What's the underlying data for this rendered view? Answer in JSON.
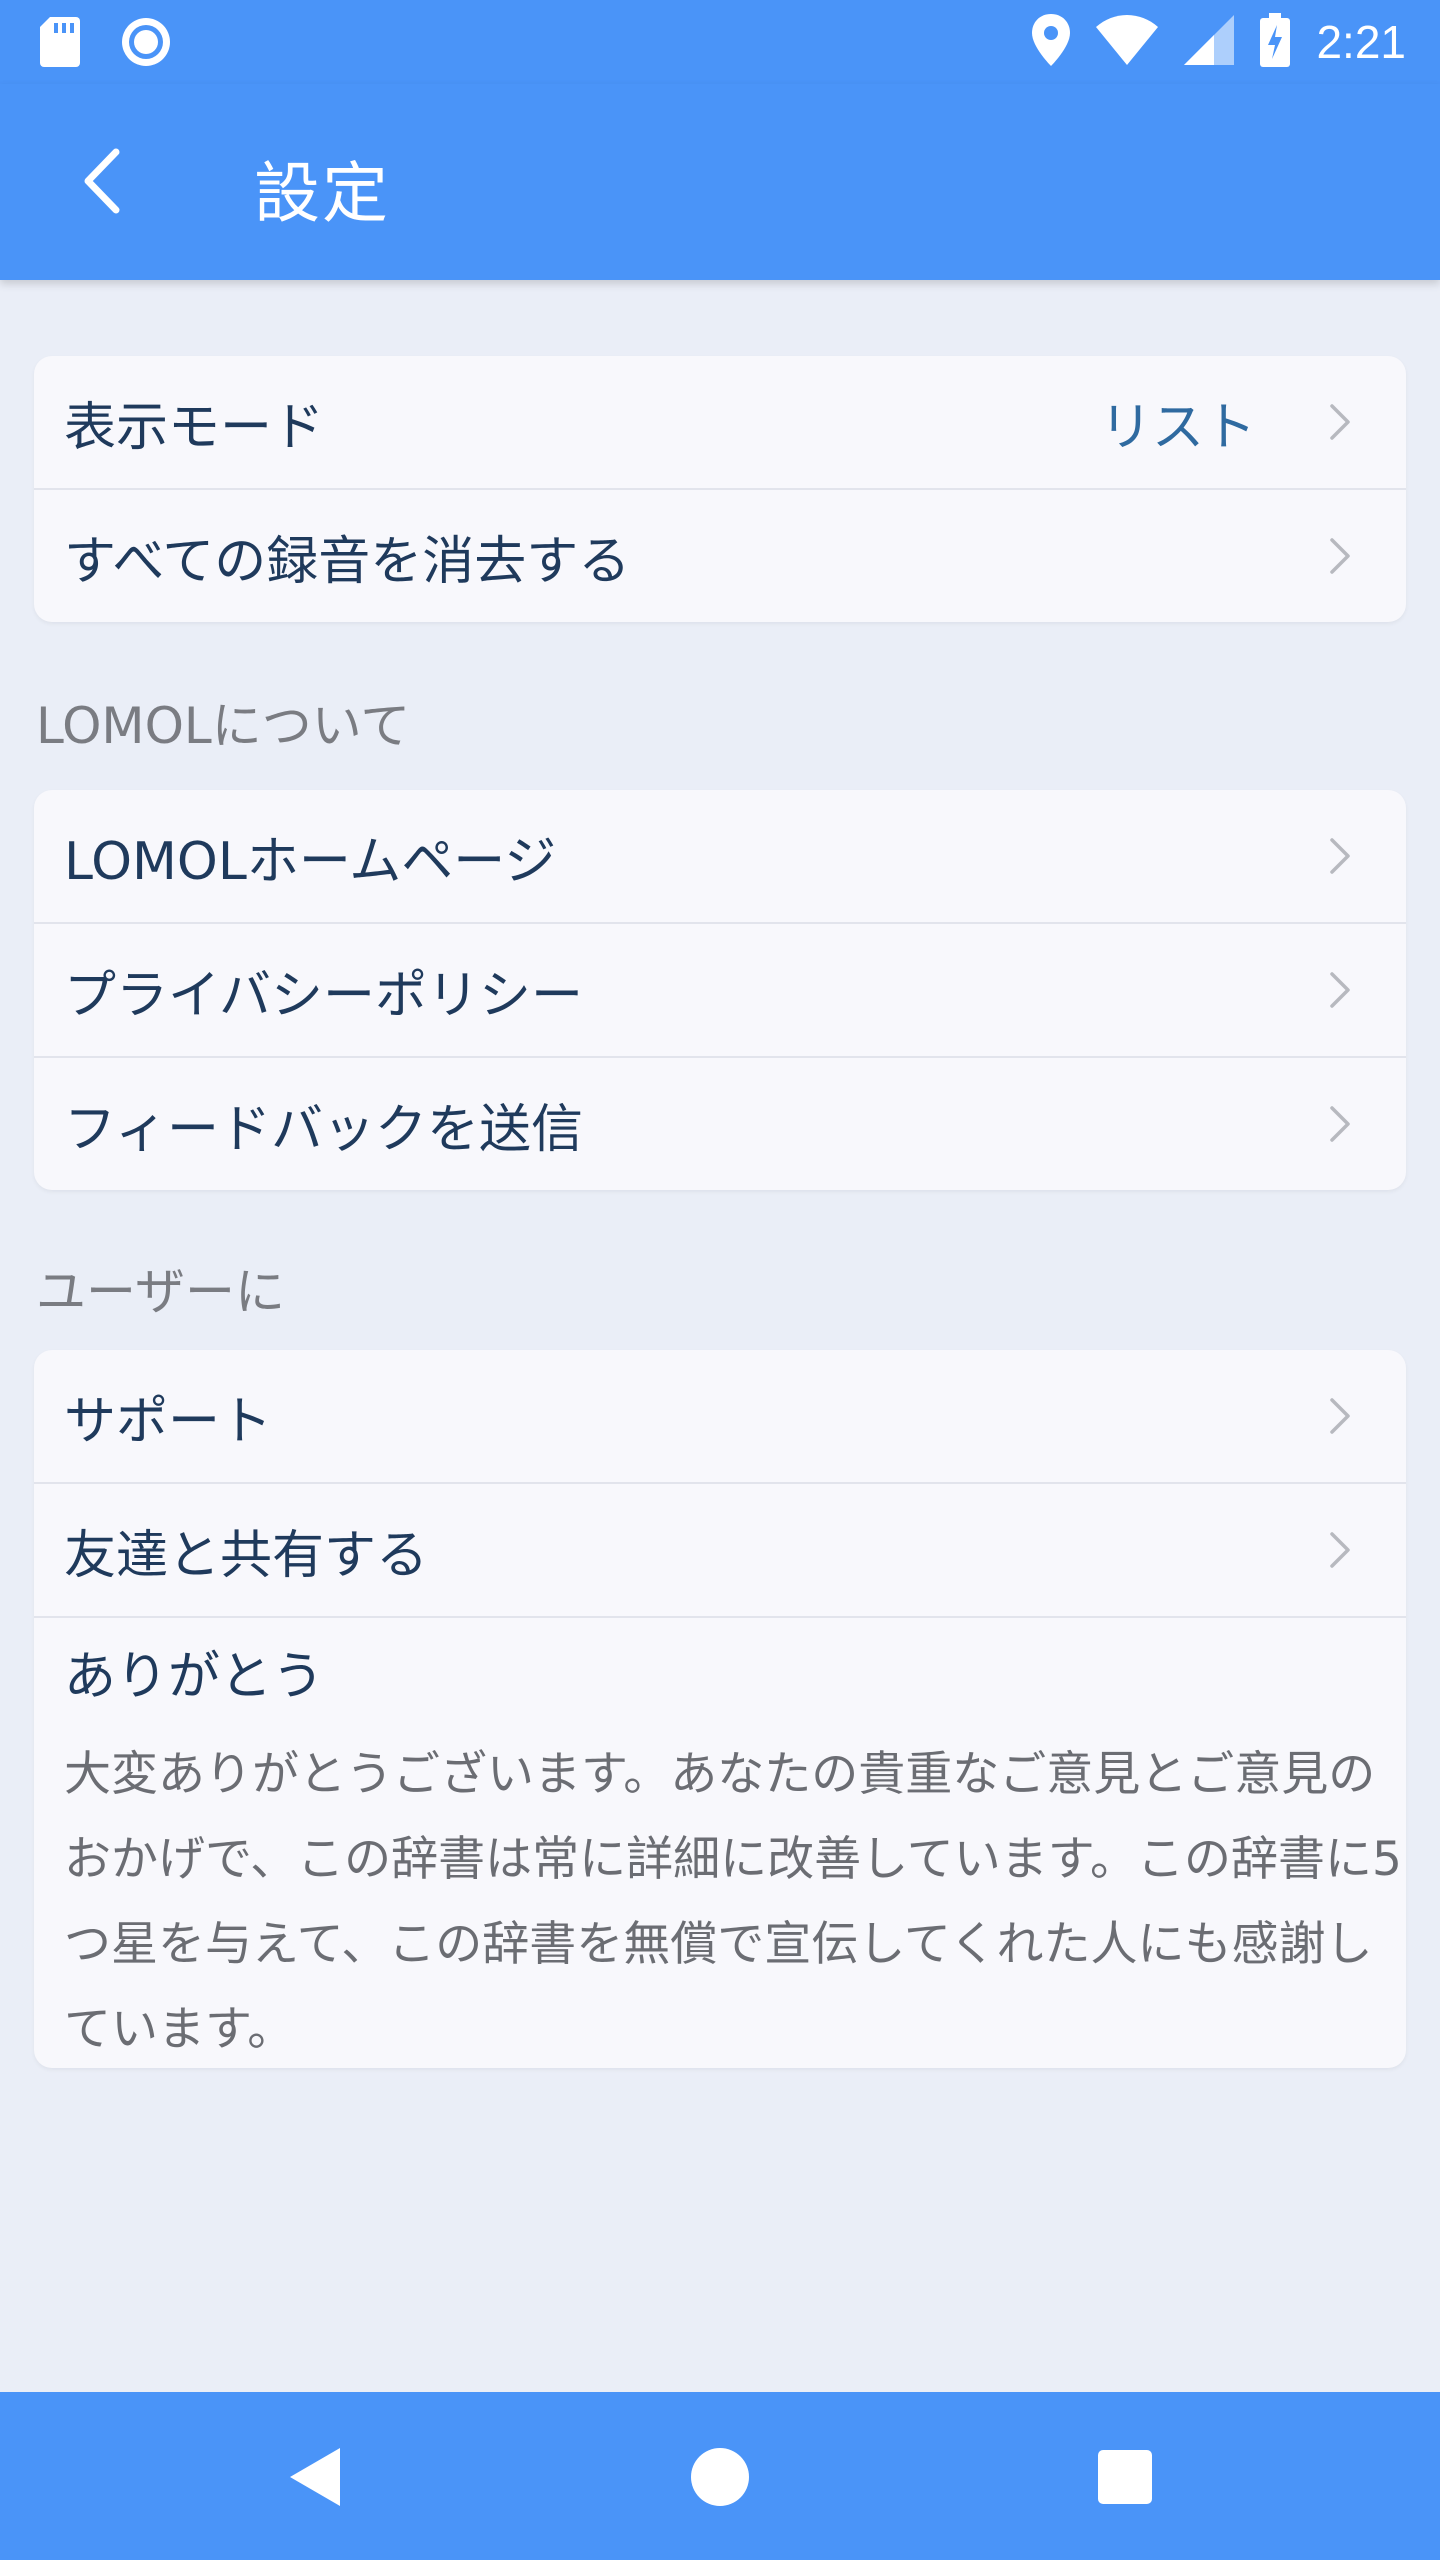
{
  "status_bar": {
    "time": "2:21",
    "icons": [
      "sd-card-icon",
      "record-icon",
      "location-icon",
      "wifi-icon",
      "signal-icon",
      "battery-charging-icon"
    ]
  },
  "app_bar": {
    "title": "設定",
    "back_icon": "chevron-left-icon"
  },
  "settings": {
    "display_mode_label": "表示モード",
    "display_mode_value": "リスト",
    "delete_all_label": "すべての録音を消去する"
  },
  "about": {
    "header": "LOMOLについて",
    "items": [
      {
        "label": "LOMOLホームページ"
      },
      {
        "label": "プライバシーポリシー"
      },
      {
        "label": "フィードバックを送信"
      }
    ]
  },
  "users": {
    "header": "ユーザーに",
    "items": [
      {
        "label": "サポート"
      },
      {
        "label": "友達と共有する"
      }
    ],
    "thanks_title": "ありがとう",
    "thanks_body": " 大変ありがとうございます。あなたの貴重なご意見とご意見のおかげで、この辞書は常に詳細に改善しています。この辞書に5つ星を与えて、この辞書を無償で宣伝してくれた人にも感謝しています。"
  },
  "nav_bar": {
    "icons": [
      "nav-back-icon",
      "nav-home-icon",
      "nav-recents-icon"
    ]
  },
  "colors": {
    "primary": "#4a94f8",
    "background": "#eaeef7",
    "card": "#f8f8fc",
    "label_text": "#1f3a5c",
    "value_text": "#2f6aa0",
    "secondary_text": "#7a7c82"
  }
}
